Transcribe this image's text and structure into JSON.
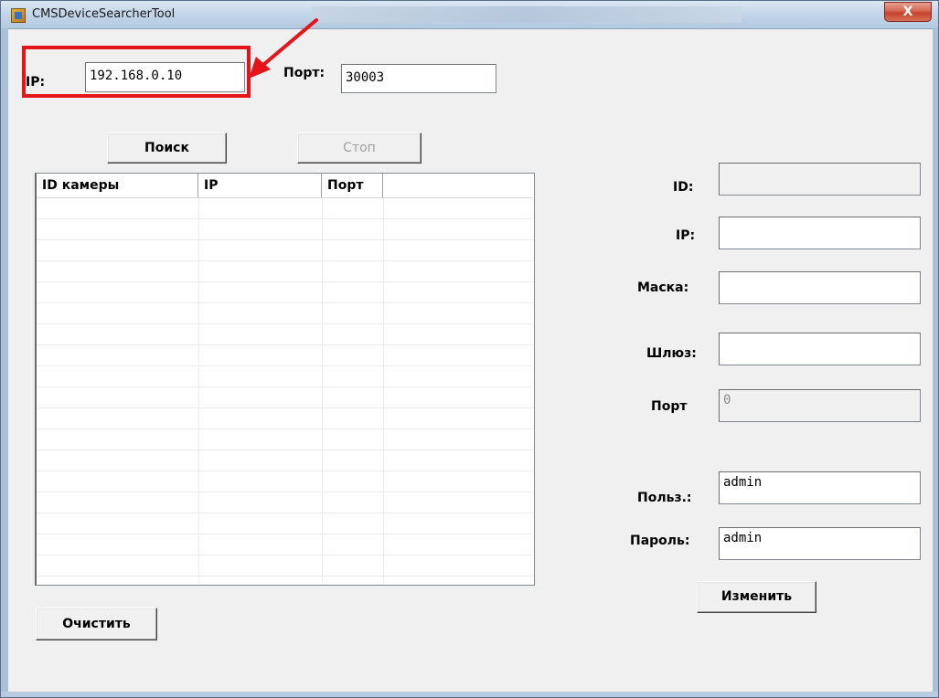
{
  "window": {
    "title": "CMSDeviceSearcherTool",
    "close_glyph": "X"
  },
  "search": {
    "ip_label": "IP:",
    "ip_value": "192.168.0.10",
    "port_label": "Порт:",
    "port_value": "30003",
    "search_button": "Поиск",
    "stop_button": "Стоп",
    "clear_button": "Очистить"
  },
  "table": {
    "columns": [
      "ID камеры",
      "IP",
      "Порт",
      ""
    ]
  },
  "details": {
    "id_label": "ID:",
    "id_value": "",
    "ip_label": "IP:",
    "ip_value": "",
    "mask_label": "Маска:",
    "mask_value": "",
    "gateway_label": "Шлюз:",
    "gateway_value": "",
    "port_label": "Порт",
    "port_value": "0",
    "user_label": "Польз.:",
    "user_value": "admin",
    "password_label": "Пароль:",
    "password_value": "admin",
    "change_button": "Изменить"
  },
  "annotation": {
    "highlight_color": "#e4141b"
  }
}
